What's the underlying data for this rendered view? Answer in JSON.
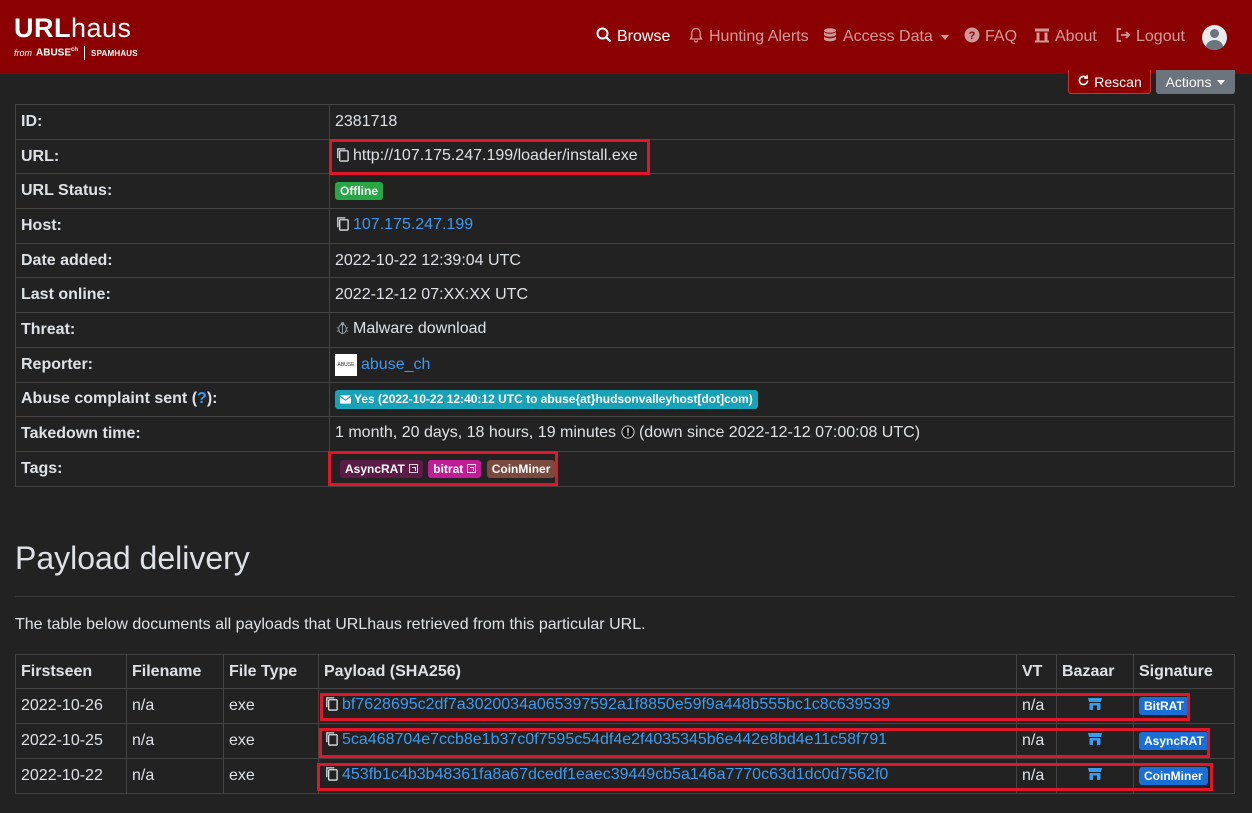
{
  "brand": {
    "title_bold": "URL",
    "title_rest": "haus",
    "sub_from": "from",
    "sub_abuse": "ABUSE",
    "sub_abuse_sup": "ch",
    "sub_spam": "SPAMHAUS"
  },
  "nav": [
    {
      "label": "Browse",
      "icon": "search-icon"
    },
    {
      "label": "Hunting Alerts",
      "icon": "bell-icon"
    },
    {
      "label": "Access Data",
      "icon": "database-icon"
    },
    {
      "label": "FAQ",
      "icon": "question-circle-icon"
    },
    {
      "label": "About",
      "icon": "bank-icon"
    },
    {
      "label": "Logout",
      "icon": "logout-icon"
    }
  ],
  "actions": {
    "rescan": "Rescan",
    "actions": "Actions"
  },
  "info": {
    "id_label": "ID:",
    "id": "2381718",
    "url_label": "URL:",
    "url": "http://107.175.247.199/loader/install.exe",
    "status_label": "URL Status:",
    "status": "Offline",
    "host_label": "Host:",
    "host": "107.175.247.199",
    "date_added_label": "Date added:",
    "date_added": "2022-10-22 12:39:04 UTC",
    "last_online_label": "Last online:",
    "last_online": "2022-12-12 07:XX:XX UTC",
    "threat_label": "Threat:",
    "threat": "Malware download",
    "reporter_label": "Reporter:",
    "reporter": "abuse_ch",
    "abuse_label": "Abuse complaint sent (",
    "abuse_q": "?",
    "abuse_label_end": "):",
    "abuse_value": "Yes (2022-10-22 12:40:12 UTC to abuse{at}hudsonvalleyhost[dot]com)",
    "takedown_label": "Takedown time:",
    "takedown": "1 month, 20 days, 18 hours, 19 minutes",
    "takedown_note": "(down since 2022-12-12 07:00:08 UTC)",
    "tags_label": "Tags:",
    "tags": [
      {
        "label": "AsyncRAT",
        "color": "#5c1a46",
        "external": true
      },
      {
        "label": "bitrat",
        "color": "#c21c96",
        "external": true
      },
      {
        "label": "CoinMiner",
        "color": "#7a4a3e",
        "external": false
      }
    ]
  },
  "payload_section": {
    "title": "Payload delivery",
    "description": "The table below documents all payloads that URLhaus retrieved from this particular URL.",
    "columns": [
      "Firstseen",
      "Filename",
      "File Type",
      "Payload (SHA256)",
      "VT",
      "Bazaar",
      "Signature"
    ],
    "rows": [
      {
        "firstseen": "2022-10-26",
        "filename": "n/a",
        "filetype": "exe",
        "sha256": "bf7628695c2df7a3020034a065397592a1f8850e59f9a448b555bc1c8c639539",
        "vt": "n/a",
        "signature": "BitRAT"
      },
      {
        "firstseen": "2022-10-25",
        "filename": "n/a",
        "filetype": "exe",
        "sha256": "5ca468704e7ccb8e1b37c0f7595c54df4e2f4035345b6e442e8bd4e11c58f791",
        "vt": "n/a",
        "signature": "AsyncRAT"
      },
      {
        "firstseen": "2022-10-22",
        "filename": "n/a",
        "filetype": "exe",
        "sha256": "453fb1c4b3b48361fa8a67dcedf1eaec39449cb5a146a7770c63d1dc0d7562f0",
        "vt": "n/a",
        "signature": "CoinMiner"
      }
    ]
  },
  "colors": {
    "navbar": "#8b0000",
    "link": "#3a9bf0",
    "highlight": "#e0162b",
    "offline_badge": "#28a745",
    "abuse_badge": "#17a2b8",
    "signature_badge": "#1a6fd6"
  }
}
